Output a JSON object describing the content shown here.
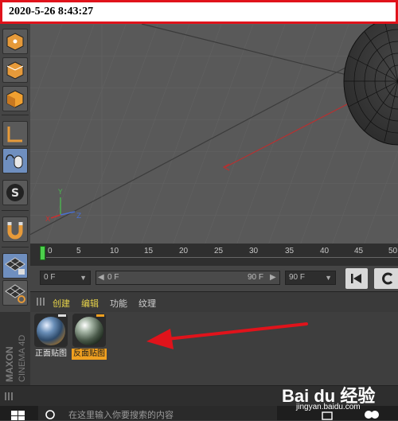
{
  "timestamp": "2020-5-26 8:43:27",
  "timeline": {
    "ticks": [
      "0",
      "5",
      "10",
      "15",
      "20",
      "25",
      "30",
      "35",
      "40",
      "45",
      "50"
    ]
  },
  "frame_controls": {
    "start_field": "0 F",
    "current_range_start": "0 F",
    "current_range_end": "90 F",
    "end_field": "90 F"
  },
  "material_manager": {
    "menu": [
      "创建",
      "编辑",
      "功能",
      "纹理"
    ],
    "materials": [
      {
        "label": "正面贴图",
        "selected": false
      },
      {
        "label": "反面贴图",
        "selected": true
      }
    ]
  },
  "brand": "MAXON CINEMA 4D",
  "taskbar": {
    "search_placeholder": "在这里输入你要搜索的内容"
  },
  "watermark": {
    "logo": "Bai du 经验",
    "url": "jingyan.baidu.com"
  },
  "colors": {
    "accent_red": "#e0131b",
    "selected_blue": "#6f8fbf",
    "selected_orange": "#f0a020",
    "menu_yellow": "#e8d44a"
  }
}
